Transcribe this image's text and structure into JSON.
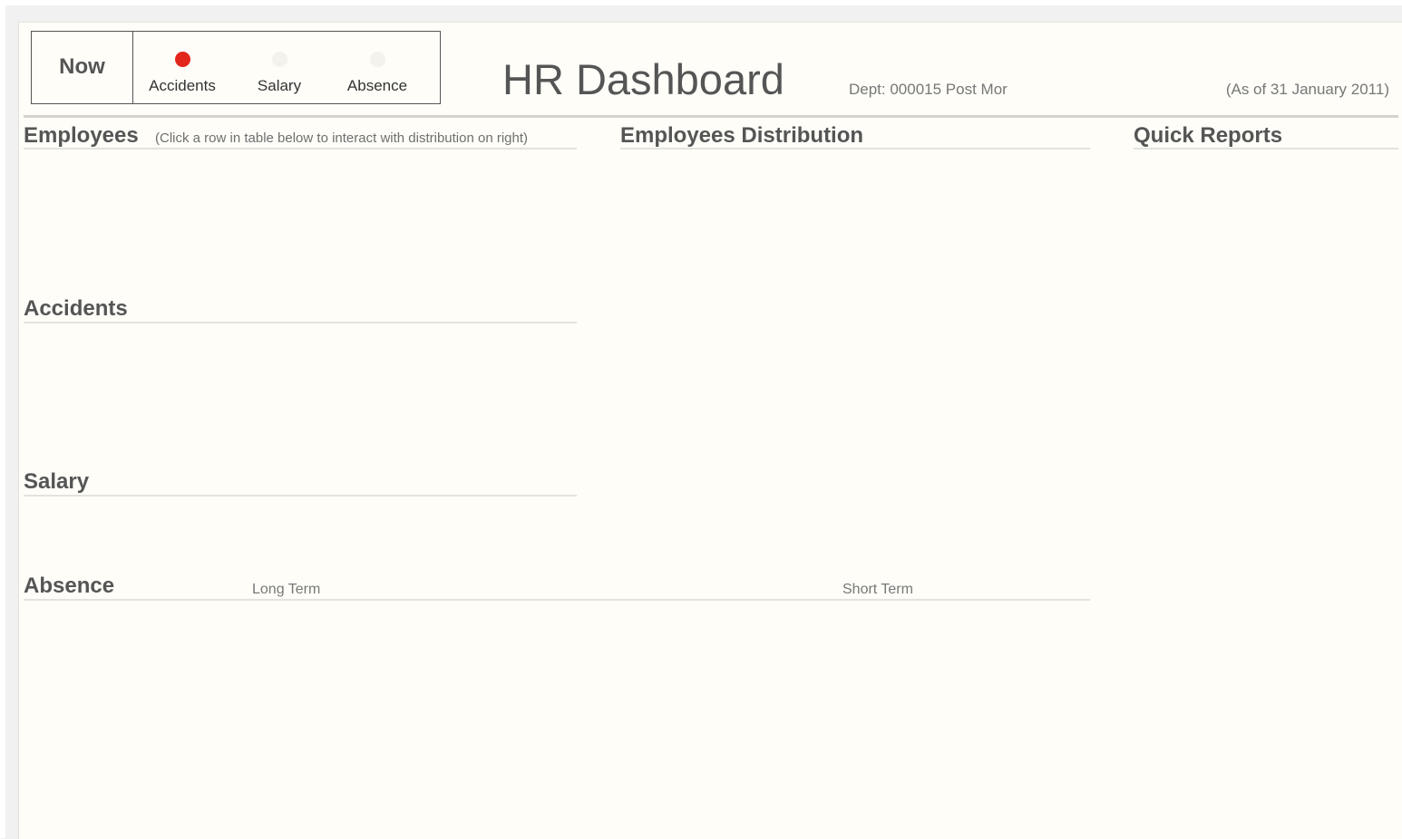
{
  "status_bar": {
    "now_label": "Now",
    "items": [
      {
        "label": "Accidents",
        "status_color": "#e3261c",
        "status": "alert"
      },
      {
        "label": "Salary",
        "status_color": "#f3f2ec",
        "status": "inactive"
      },
      {
        "label": "Absence",
        "status_color": "#f3f2ec",
        "status": "inactive"
      }
    ]
  },
  "header": {
    "title": "HR Dashboard",
    "dept": "Dept: 000015 Post Mor",
    "as_of": "(As of 31 January 2011)"
  },
  "sections": {
    "employees": {
      "title": "Employees",
      "hint": "(Click a row in table below to interact with distribution on right)"
    },
    "distribution": {
      "title": "Employees Distribution"
    },
    "quick_reports": {
      "title": "Quick Reports"
    },
    "accidents": {
      "title": "Accidents"
    },
    "salary": {
      "title": "Salary"
    },
    "absence": {
      "title": "Absence",
      "long_term": "Long Term",
      "short_term": "Short Term"
    }
  },
  "colors": {
    "page_bg": "#fefdf8",
    "heading_text": "#555555",
    "rule": "#e3e3de",
    "alert": "#e3261c"
  }
}
